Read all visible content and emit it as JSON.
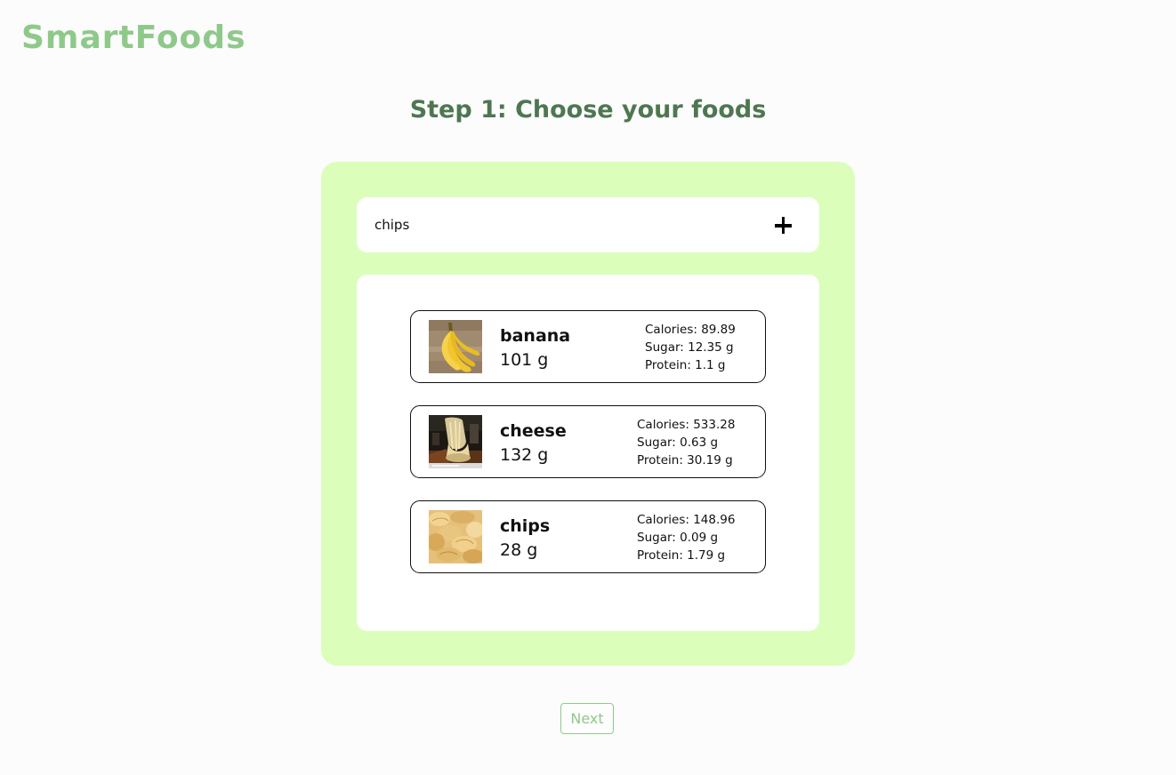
{
  "app": {
    "title": "SmartFoods"
  },
  "page": {
    "heading": "Step 1: Choose your foods"
  },
  "search": {
    "value": "chips",
    "add_icon": "plus-icon"
  },
  "foods": [
    {
      "name": "banana",
      "quantity": "101 g",
      "calories": "Calories: 89.89",
      "sugar": "Sugar: 12.35 g",
      "protein": "Protein: 1.1 g",
      "image": "banana-image"
    },
    {
      "name": "cheese",
      "quantity": "132 g",
      "calories": "Calories: 533.28",
      "sugar": "Sugar: 0.63 g",
      "protein": "Protein: 30.19 g",
      "image": "cheese-image"
    },
    {
      "name": "chips",
      "quantity": "28 g",
      "calories": "Calories: 148.96",
      "sugar": "Sugar: 0.09 g",
      "protein": "Protein: 1.79 g",
      "image": "chips-image"
    }
  ],
  "actions": {
    "next_label": "Next"
  },
  "colors": {
    "brand": "#8fc98a",
    "heading": "#4e7751",
    "panel": "#dcfebb",
    "background": "#fcfcfc"
  }
}
